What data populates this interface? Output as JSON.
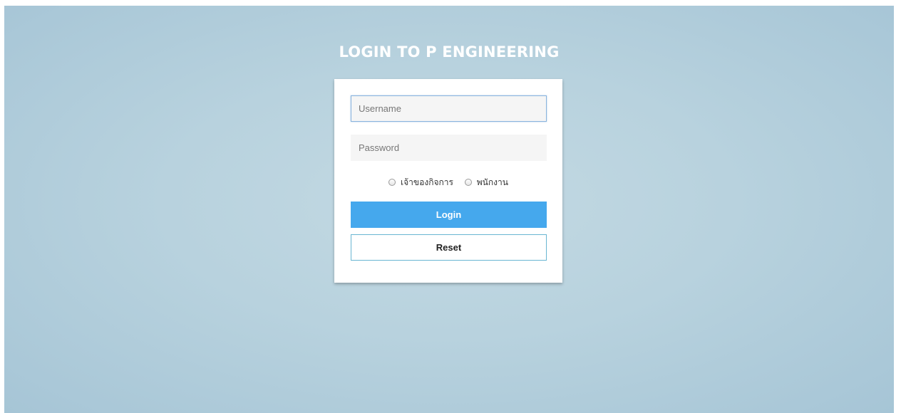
{
  "page": {
    "title": "LOGIN TO P ENGINEERING"
  },
  "form": {
    "username": {
      "value": "",
      "placeholder": "Username"
    },
    "password": {
      "value": "",
      "placeholder": "Password"
    },
    "roles": [
      {
        "label": "เจ้าของกิจการ",
        "selected": false
      },
      {
        "label": "พนักงาน",
        "selected": false
      }
    ],
    "login_label": "Login",
    "reset_label": "Reset"
  },
  "colors": {
    "background": "#b8d2de",
    "login_button": "#45a8ed",
    "reset_border": "#69b6d2"
  }
}
